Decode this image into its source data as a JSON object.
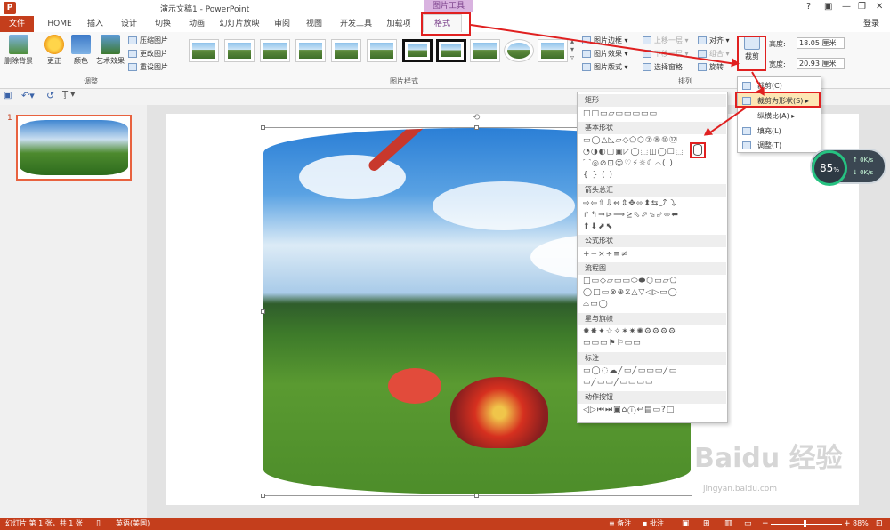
{
  "titlebar": {
    "app_icon": "P",
    "title": "演示文稿1 - PowerPoint",
    "context_label": "图片工具",
    "help": "?",
    "login": "登录"
  },
  "tabs": [
    "文件",
    "HOME",
    "插入",
    "设计",
    "切换",
    "动画",
    "幻灯片放映",
    "审阅",
    "视图",
    "开发工具",
    "加载项",
    "格式"
  ],
  "ribbon": {
    "adjust": {
      "remove_bg": "删除背景",
      "corrections": "更正",
      "color": "颜色",
      "artistic": "艺术效果",
      "compress": "压缩图片",
      "change": "更改图片",
      "reset": "重设图片",
      "group_label": "调整"
    },
    "styles": {
      "group_label": "图片样式"
    },
    "picture_options": {
      "border": "图片边框",
      "effects": "图片效果",
      "layout": "图片版式"
    },
    "arrange": {
      "bring_forward": "上移一层",
      "send_backward": "下移一层",
      "selection_pane": "选择窗格",
      "align": "对齐",
      "group": "组合",
      "rotate": "旋转",
      "group_label": "排列"
    },
    "size": {
      "crop": "裁剪",
      "height_label": "高度:",
      "height_value": "18.05 厘米",
      "width_label": "宽度:",
      "width_value": "20.93 厘米"
    }
  },
  "slides_panel": {
    "slide_number": "1"
  },
  "shape_menu": {
    "categories": [
      "矩形",
      "基本形状",
      "箭头总汇",
      "公式形状",
      "流程图",
      "星与旗帜",
      "标注",
      "动作按钮"
    ],
    "rows": {
      "rect": [
        "□□▭▱▭▭▭▭▭"
      ],
      "basic": [
        "▭◯△◺▱◇⬠⬡⑦⑧⑩⑫",
        "◔◑◐▢▣◸◯⬚◫◯☐⬚",
        "⌒◎⊘⊡☺♡⚡☼☾⌓(  )",
        "{  }  (  )"
      ],
      "arrows": [
        "⇨⇦⇧⇩⇔⇕✥⬄⬍⇆⤴⤵",
        "↱↰⇒⊳⟹⊵⬁⬀⬂⬃⬄⬅",
        "⬆⬇⬈⬉"
      ],
      "equation": [
        "+−×÷≡≠"
      ],
      "flowchart": [
        "□▭◇▱▭▭⬭⬬⬡▭▱⬠",
        "◯□▭⊗⊕⧖△▽◁▷▭◯",
        "⌓▭◯"
      ],
      "stars": [
        "✹✸✦☆✧✶✷✺⚙⚙⚙⚙",
        "▭▭▭⚑⚐▭▭"
      ],
      "callouts": [
        "▭◯◌☁╱▭╱▭▭▭╱▭",
        "▭╱▭▭╱▭▭▭▭"
      ],
      "actions": [
        "◁▷⏮⏭▣⌂ⓘ↩▤▭?□"
      ]
    }
  },
  "crop_menu": {
    "crop": "裁剪(C)",
    "crop_to_shape": "裁剪为形状(S)",
    "aspect_ratio": "纵横比(A)",
    "fill": "填充(L)",
    "fit": "调整(T)"
  },
  "net_widget": {
    "percent": "85",
    "unit": "%",
    "up": "0K/s",
    "down": "0K/s"
  },
  "watermark": {
    "logo": "Baidu 经验",
    "url": "jingyan.baidu.com"
  },
  "statusbar": {
    "slide_info": "幻灯片 第 1 张，共 1 张",
    "language": "英语(美国)",
    "notes": "备注",
    "comments": "批注",
    "zoom": "88%"
  },
  "colors": {
    "brand": "#c43e1c",
    "context": "#7a3f8a",
    "highlight": "#e02020"
  }
}
